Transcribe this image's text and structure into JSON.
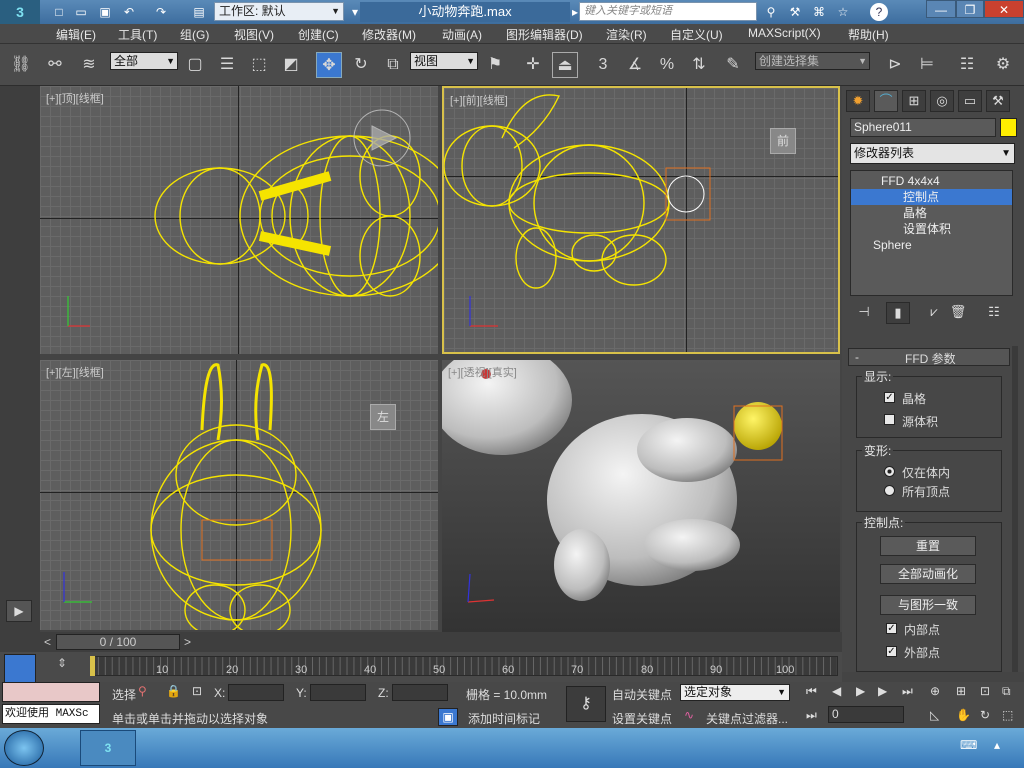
{
  "titlebar": {
    "workspace_label": "工作区: 默认",
    "file_name": "小动物奔跑.max",
    "search_placeholder": "键入关键字或短语"
  },
  "menu": {
    "items": [
      "编辑(E)",
      "工具(T)",
      "组(G)",
      "视图(V)",
      "创建(C)",
      "修改器(M)",
      "动画(A)",
      "图形编辑器(D)",
      "渲染(R)",
      "自定义(U)",
      "MAXScript(X)",
      "帮助(H)"
    ]
  },
  "toolbar": {
    "selection_filter": "全部",
    "reference_coord": "视图",
    "named_selection": "创建选择集",
    "snap_3": "3",
    "angle_snap_pct": "%"
  },
  "viewports": {
    "top_label": "[+][顶][线框]",
    "front_label": "[+][前][线框]",
    "left_label": "[+][左][线框]",
    "persp_label": "[+][透视][真实]",
    "top_cube": "",
    "front_cube": "前",
    "left_cube": "左"
  },
  "cmdpanel": {
    "object_name": "Sphere011",
    "swatch_color": "#ffee00",
    "modifier_list": "修改器列表",
    "stack": [
      "FFD 4x4x4",
      "控制点",
      "晶格",
      "设置体积",
      "Sphere"
    ],
    "rollout_title": "FFD 参数",
    "display_group": "显示:",
    "display_opts": [
      "晶格",
      "源体积"
    ],
    "deform_group": "变形:",
    "deform_opts": [
      "仅在体内",
      "所有顶点"
    ],
    "cp_group": "控制点:",
    "btn_reset": "重置",
    "btn_animate_all": "全部动画化",
    "btn_conform": "与图形一致",
    "chk_inner": "内部点",
    "chk_outer": "外部点"
  },
  "timeline": {
    "frame_display": "0 / 100",
    "ticks": [
      "10",
      "20",
      "30",
      "40",
      "50",
      "60",
      "70",
      "80",
      "90",
      "100"
    ]
  },
  "status": {
    "welcome": "欢迎使用 MAXSc",
    "select_label": "选择",
    "x_label": "X:",
    "y_label": "Y:",
    "z_label": "Z:",
    "grid": "栅格 = 10.0mm",
    "prompt": "单击或单击并拖动以选择对象",
    "add_time_tag": "添加时间标记",
    "auto_key": "自动关键点",
    "set_key": "设置关键点",
    "key_mode": "选定对象",
    "key_filter": "关键点过滤器...",
    "frame_value": "0"
  }
}
